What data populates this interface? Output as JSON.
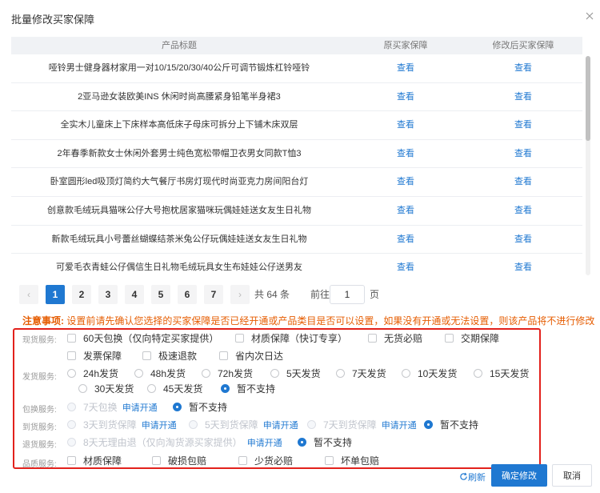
{
  "dialog": {
    "title": "批量修改买家保障"
  },
  "table": {
    "headers": {
      "title": "产品标题",
      "original": "原买家保障",
      "modified": "修改后买家保障"
    },
    "rows": [
      {
        "title": "哑铃男士健身器材家用一对10/15/20/30/40公斤可调节锻炼杠铃哑铃",
        "original": "查看",
        "modified": "查看"
      },
      {
        "title": "2亚马逊女装欧美INS 休闲时尚高腰紧身铅笔半身裙3",
        "original": "查看",
        "modified": "查看"
      },
      {
        "title": "全实木儿童床上下床样本高低床子母床可拆分上下铺木床双层",
        "original": "查看",
        "modified": "查看"
      },
      {
        "title": "2年春季新款女士休闲外套男士纯色宽松带帽卫衣男女同款T恤3",
        "original": "查看",
        "modified": "查看"
      },
      {
        "title": "卧室圆形led吸顶灯简约大气餐厅书房灯现代时尚亚克力房间阳台灯",
        "original": "查看",
        "modified": "查看"
      },
      {
        "title": "创意款毛绒玩具猫咪公仔大号抱枕居家猫咪玩偶娃娃送女友生日礼物",
        "original": "查看",
        "modified": "查看"
      },
      {
        "title": "新款毛绒玩具小号蕾丝蝴蝶结茶米兔公仔玩偶娃娃送女友生日礼物",
        "original": "查看",
        "modified": "查看"
      },
      {
        "title": "可爱毛衣青蛙公仔偶信生日礼物毛绒玩具女生布娃娃公仔送男友",
        "original": "查看",
        "modified": "查看"
      }
    ]
  },
  "pagination": {
    "prev": "‹",
    "next": "›",
    "pages": [
      "1",
      "2",
      "3",
      "4",
      "5",
      "6",
      "7"
    ],
    "current": "1",
    "total": "共 64 条",
    "goto_label": "前往",
    "goto_value": "1",
    "page_suffix": "页"
  },
  "notice": {
    "label": "注意事项:",
    "text": "设置前请先确认您选择的买家保障是否已经开通或产品类目是否可以设置，如果没有开通或无法设置，则该产品将不进行修改"
  },
  "options": {
    "stock": {
      "label": "现货服务:",
      "items": [
        "60天包换（仅向特定买家提供）",
        "材质保障（快订专享）",
        "无货必赔",
        "交期保障",
        "发票保障",
        "极速退款",
        "省内次日达"
      ]
    },
    "shipping": {
      "label": "发货服务:",
      "items": [
        "24h发货",
        "48h发货",
        "72h发货",
        "5天发货",
        "7天发货",
        "10天发货",
        "15天发货",
        "30天发货",
        "45天发货",
        "暂不支持"
      ],
      "selected": "暂不支持"
    },
    "exchange": {
      "label": "包换服务:",
      "disabled_option": "7天包换",
      "apply": "申请开通",
      "unsupported": "暂不支持"
    },
    "arrival": {
      "label": "到货服务:",
      "items": [
        {
          "label": "3天到货保障",
          "apply": "申请开通"
        },
        {
          "label": "5天到货保障",
          "apply": "申请开通"
        },
        {
          "label": "7天到货保障",
          "apply": "申请开通"
        }
      ],
      "unsupported": "暂不支持"
    },
    "refund": {
      "label": "退货服务:",
      "disabled_option": "8天无理由退（仅向淘货源买家提供）",
      "apply": "申请开通",
      "unsupported": "暂不支持"
    },
    "quality": {
      "label": "品质服务:",
      "items": [
        "材质保障",
        "破损包赔",
        "少货必赔",
        "坏单包赔"
      ]
    }
  },
  "footer": {
    "refresh": "刷新",
    "confirm": "确定修改",
    "cancel": "取消"
  },
  "colors": {
    "accent": "#1f78d1",
    "warning": "#e65c00",
    "highlight_border": "#e2211c"
  }
}
